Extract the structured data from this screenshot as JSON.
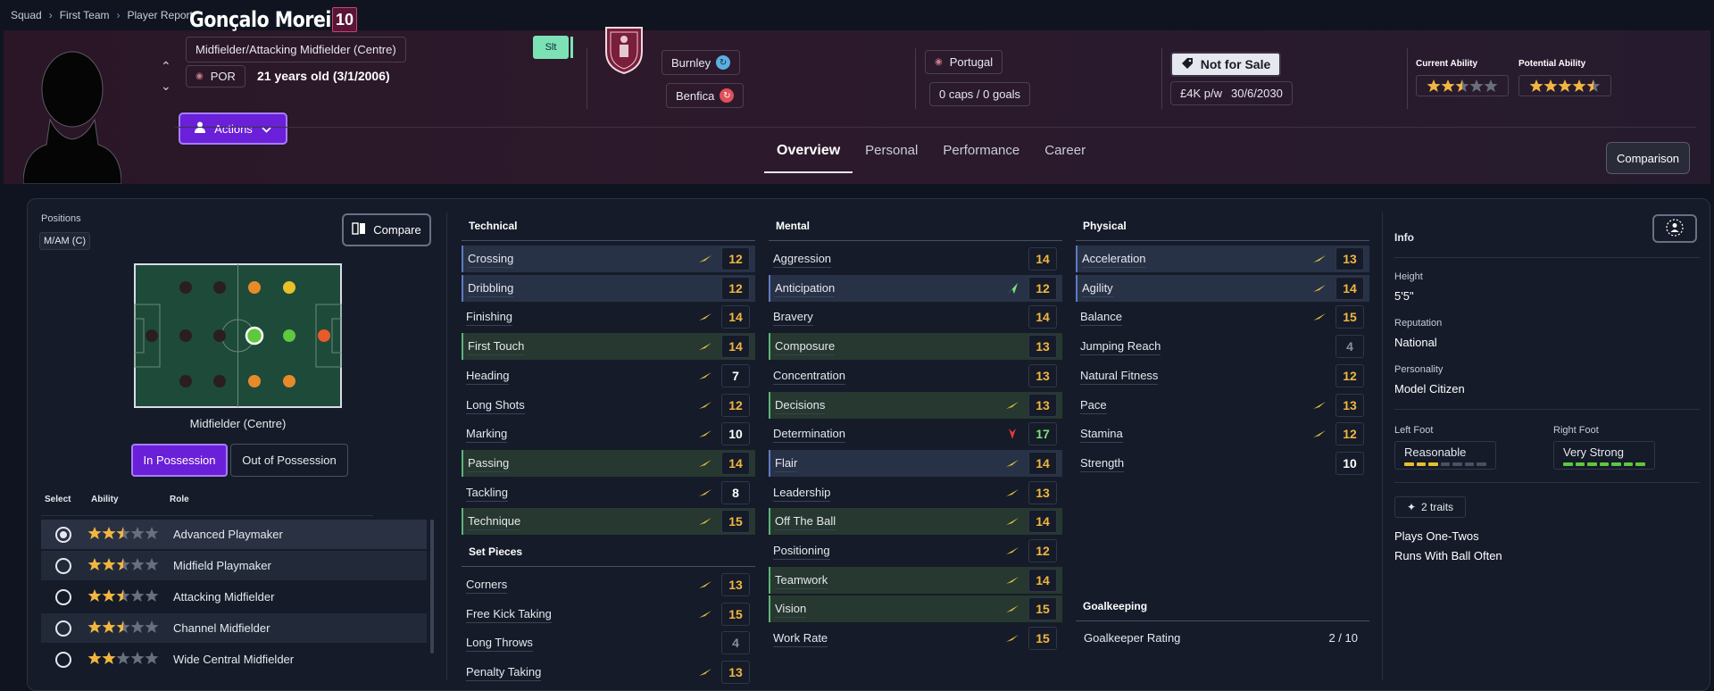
{
  "breadcrumb": [
    "Squad",
    "First Team",
    "Player Report"
  ],
  "player": {
    "name": "Gonçalo Moreira",
    "shirt_number": "10",
    "position": "Midfielder/Attacking Midfielder (Centre)",
    "nationality_code": "POR",
    "age_text": "21 years old (3/1/2006)",
    "status_tag": "Slt"
  },
  "clubs": {
    "current": "Burnley",
    "loan": "Benfica"
  },
  "international": {
    "country": "Portugal",
    "caps": "0 caps / 0 goals"
  },
  "contract": {
    "transfer_status": "Not for Sale",
    "wage": "£4K p/w",
    "expiry": "30/6/2030"
  },
  "ability": {
    "current_label": "Current Ability",
    "current_stars": 2.5,
    "potential_label": "Potential Ability",
    "potential_stars": 4.5
  },
  "actions_label": "Actions",
  "tabs": [
    "Overview",
    "Personal",
    "Performance",
    "Career"
  ],
  "comparison_label": "Comparison",
  "positions": {
    "label": "Positions",
    "value": "M/AM (C)",
    "compare_label": "Compare",
    "pitch_label": "Midfielder (Centre)",
    "in_possession": "In Possession",
    "out_possession": "Out of Possession"
  },
  "roles": {
    "headers": [
      "Select",
      "Ability",
      "Role"
    ],
    "items": [
      {
        "name": "Advanced Playmaker",
        "stars": 2.5,
        "selected": true
      },
      {
        "name": "Midfield Playmaker",
        "stars": 2.5,
        "selected": false
      },
      {
        "name": "Attacking Midfielder",
        "stars": 2.5,
        "selected": false
      },
      {
        "name": "Channel Midfielder",
        "stars": 2.5,
        "selected": false
      },
      {
        "name": "Wide Central Midfielder",
        "stars": 2,
        "selected": false
      }
    ]
  },
  "technical": {
    "title": "Technical",
    "items": [
      {
        "name": "Crossing",
        "value": "12",
        "hl": "blue",
        "trend": "up"
      },
      {
        "name": "Dribbling",
        "value": "12",
        "hl": "blue",
        "trend": ""
      },
      {
        "name": "Finishing",
        "value": "14",
        "hl": "",
        "trend": "up"
      },
      {
        "name": "First Touch",
        "value": "14",
        "hl": "green",
        "trend": "up"
      },
      {
        "name": "Heading",
        "value": "7",
        "hl": "",
        "trend": "up"
      },
      {
        "name": "Long Shots",
        "value": "12",
        "hl": "",
        "trend": "up"
      },
      {
        "name": "Marking",
        "value": "10",
        "hl": "",
        "trend": "up"
      },
      {
        "name": "Passing",
        "value": "14",
        "hl": "green",
        "trend": "up"
      },
      {
        "name": "Tackling",
        "value": "8",
        "hl": "",
        "trend": "up"
      },
      {
        "name": "Technique",
        "value": "15",
        "hl": "green",
        "trend": "up"
      }
    ]
  },
  "set_pieces": {
    "title": "Set Pieces",
    "items": [
      {
        "name": "Corners",
        "value": "13",
        "hl": "",
        "trend": "up"
      },
      {
        "name": "Free Kick Taking",
        "value": "15",
        "hl": "",
        "trend": "up"
      },
      {
        "name": "Long Throws",
        "value": "4",
        "hl": "",
        "trend": ""
      },
      {
        "name": "Penalty Taking",
        "value": "13",
        "hl": "",
        "trend": "up"
      }
    ]
  },
  "mental": {
    "title": "Mental",
    "items": [
      {
        "name": "Aggression",
        "value": "14",
        "hl": "",
        "trend": ""
      },
      {
        "name": "Anticipation",
        "value": "12",
        "hl": "blue",
        "trend": "arrow-green"
      },
      {
        "name": "Bravery",
        "value": "14",
        "hl": "",
        "trend": ""
      },
      {
        "name": "Composure",
        "value": "13",
        "hl": "green",
        "trend": ""
      },
      {
        "name": "Concentration",
        "value": "13",
        "hl": "",
        "trend": ""
      },
      {
        "name": "Decisions",
        "value": "13",
        "hl": "green",
        "trend": "up"
      },
      {
        "name": "Determination",
        "value": "17",
        "hl": "",
        "trend": "arrow-red"
      },
      {
        "name": "Flair",
        "value": "14",
        "hl": "blue",
        "trend": "up"
      },
      {
        "name": "Leadership",
        "value": "13",
        "hl": "",
        "trend": "up"
      },
      {
        "name": "Off The Ball",
        "value": "14",
        "hl": "green",
        "trend": "up"
      },
      {
        "name": "Positioning",
        "value": "12",
        "hl": "",
        "trend": "up"
      },
      {
        "name": "Teamwork",
        "value": "14",
        "hl": "green",
        "trend": "up"
      },
      {
        "name": "Vision",
        "value": "15",
        "hl": "green",
        "trend": "up"
      },
      {
        "name": "Work Rate",
        "value": "15",
        "hl": "",
        "trend": "up"
      }
    ]
  },
  "physical": {
    "title": "Physical",
    "items": [
      {
        "name": "Acceleration",
        "value": "13",
        "hl": "blue",
        "trend": "up"
      },
      {
        "name": "Agility",
        "value": "14",
        "hl": "blue",
        "trend": "up"
      },
      {
        "name": "Balance",
        "value": "15",
        "hl": "",
        "trend": "up"
      },
      {
        "name": "Jumping Reach",
        "value": "4",
        "hl": "",
        "trend": ""
      },
      {
        "name": "Natural Fitness",
        "value": "12",
        "hl": "",
        "trend": ""
      },
      {
        "name": "Pace",
        "value": "13",
        "hl": "",
        "trend": "up"
      },
      {
        "name": "Stamina",
        "value": "12",
        "hl": "",
        "trend": "up"
      },
      {
        "name": "Strength",
        "value": "10",
        "hl": "",
        "trend": ""
      }
    ]
  },
  "goalkeeping": {
    "title": "Goalkeeping",
    "label": "Goalkeeper Rating",
    "value": "2 / 10"
  },
  "info": {
    "title": "Info",
    "height_label": "Height",
    "height": "5'5\"",
    "reputation_label": "Reputation",
    "reputation": "National",
    "personality_label": "Personality",
    "personality": "Model Citizen",
    "left_foot_label": "Left Foot",
    "left_foot": "Reasonable",
    "left_foot_level": 3,
    "right_foot_label": "Right Foot",
    "right_foot": "Very Strong",
    "right_foot_level": 7,
    "traits_label": "2 traits",
    "traits": [
      "Plays One-Twos",
      "Runs With Ball Often"
    ]
  },
  "colors": {
    "accent": "#6a1fd8",
    "star": "#f2b640",
    "value_orange": "#f2b640",
    "value_white": "#ffffff",
    "value_green": "#7ce27c",
    "value_gray": "#8a8f9c"
  }
}
